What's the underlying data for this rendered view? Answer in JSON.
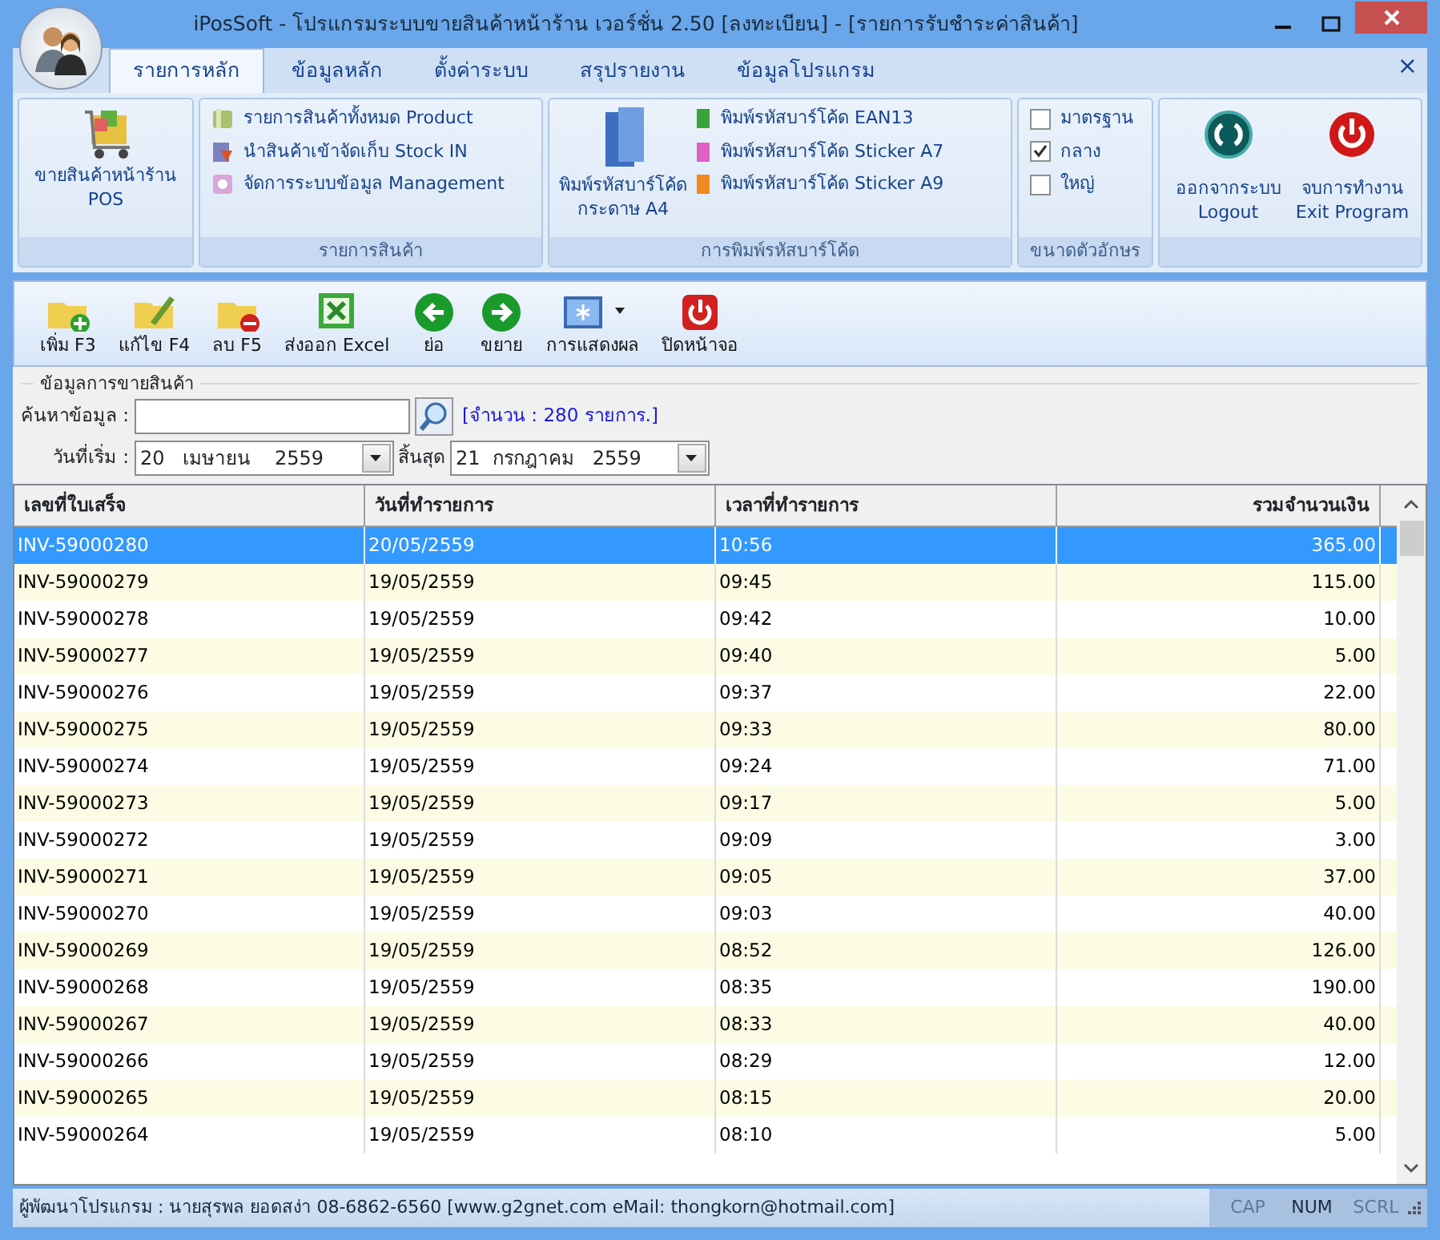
{
  "window": {
    "title": "iPosSoft - โปรแกรมระบบขายสินค้าหน้าร้าน เวอร์ชั่น 2.50 [ลงทะเบียน] - [รายการรับชำระค่าสินค้า]"
  },
  "ribbon": {
    "tabs": [
      {
        "label": "รายการหลัก",
        "selected": true
      },
      {
        "label": "ข้อมูลหลัก",
        "selected": false
      },
      {
        "label": "ตั้งค่าระบบ",
        "selected": false
      },
      {
        "label": "สรุปรายงาน",
        "selected": false
      },
      {
        "label": "ข้อมูลโปรแกรม",
        "selected": false
      }
    ],
    "close_label": "×",
    "groups": [
      {
        "kind": "pos",
        "items": [
          {
            "lines": [
              "ขายสินค้าหน้าร้าน",
              "POS"
            ]
          }
        ]
      },
      {
        "kind": "list",
        "title": "รายการสินค้า",
        "items": [
          {
            "label": "รายการสินค้าทั้งหมด Product"
          },
          {
            "label": "นำสินค้าเข้าจัดเก็บ Stock IN"
          },
          {
            "label": "จัดการระบบข้อมูล Management"
          }
        ]
      },
      {
        "kind": "barcode",
        "title": "การพิมพ์รหัสบาร์โค้ด",
        "big": {
          "lines": [
            "พิมพ์รหัสบาร์โค้ด",
            "กระดาษ A4"
          ]
        },
        "items": [
          {
            "label": "พิมพ์รหัสบาร์โค้ด EAN13",
            "color": "#3aa43a"
          },
          {
            "label": "พิมพ์รหัสบาร์โค้ด Sticker A7",
            "color": "#e060c8"
          },
          {
            "label": "พิมพ์รหัสบาร์โค้ด Sticker A9",
            "color": "#f08a20"
          }
        ]
      },
      {
        "kind": "checks",
        "title": "ขนาดตัวอักษร",
        "items": [
          {
            "label": "มาตรฐาน",
            "checked": false
          },
          {
            "label": "กลาง",
            "checked": true
          },
          {
            "label": "ใหญ่",
            "checked": false
          }
        ]
      },
      {
        "kind": "exit",
        "items": [
          {
            "lines": [
              "ออกจากระบบ",
              "Logout"
            ]
          },
          {
            "lines": [
              "จบการทำงาน",
              "Exit Program"
            ]
          }
        ]
      }
    ]
  },
  "toolbar": [
    {
      "label": "เพิ่ม F3"
    },
    {
      "label": "แก้ไข F4"
    },
    {
      "label": "ลบ F5"
    },
    {
      "label": "ส่งออก Excel"
    },
    {
      "label": "ย่อ"
    },
    {
      "label": "ขยาย"
    },
    {
      "label": "การแสดงผล"
    },
    {
      "label": "ปิดหน้าจอ"
    }
  ],
  "filter": {
    "legend": "ข้อมูลการขายสินค้า",
    "search_label": "ค้นหาข้อมูล :",
    "count": "[จำนวน : 280 รายการ.]",
    "start_label": "วันที่เริ่ม :",
    "start_date": "20   เมษายน    2559",
    "end_label": "สิ้นสุด",
    "end_date": "21  กรกฎาคม   2559"
  },
  "table": {
    "columns": [
      "เลขที่ใบเสร็จ",
      "วันที่ทำรายการ",
      "เวลาที่ทำรายการ",
      "รวมจำนวนเงิน"
    ],
    "rows": [
      {
        "cells": [
          "INV-59000280",
          "20/05/2559",
          "10:56",
          "365.00"
        ],
        "selected": true
      },
      {
        "cells": [
          "INV-59000279",
          "19/05/2559",
          "09:45",
          "115.00"
        ],
        "selected": false
      },
      {
        "cells": [
          "INV-59000278",
          "19/05/2559",
          "09:42",
          "10.00"
        ],
        "selected": false
      },
      {
        "cells": [
          "INV-59000277",
          "19/05/2559",
          "09:40",
          "5.00"
        ],
        "selected": false
      },
      {
        "cells": [
          "INV-59000276",
          "19/05/2559",
          "09:37",
          "22.00"
        ],
        "selected": false
      },
      {
        "cells": [
          "INV-59000275",
          "19/05/2559",
          "09:33",
          "80.00"
        ],
        "selected": false
      },
      {
        "cells": [
          "INV-59000274",
          "19/05/2559",
          "09:24",
          "71.00"
        ],
        "selected": false
      },
      {
        "cells": [
          "INV-59000273",
          "19/05/2559",
          "09:17",
          "5.00"
        ],
        "selected": false
      },
      {
        "cells": [
          "INV-59000272",
          "19/05/2559",
          "09:09",
          "3.00"
        ],
        "selected": false
      },
      {
        "cells": [
          "INV-59000271",
          "19/05/2559",
          "09:05",
          "37.00"
        ],
        "selected": false
      },
      {
        "cells": [
          "INV-59000270",
          "19/05/2559",
          "09:03",
          "40.00"
        ],
        "selected": false
      },
      {
        "cells": [
          "INV-59000269",
          "19/05/2559",
          "08:52",
          "126.00"
        ],
        "selected": false
      },
      {
        "cells": [
          "INV-59000268",
          "19/05/2559",
          "08:35",
          "190.00"
        ],
        "selected": false
      },
      {
        "cells": [
          "INV-59000267",
          "19/05/2559",
          "08:33",
          "40.00"
        ],
        "selected": false
      },
      {
        "cells": [
          "INV-59000266",
          "19/05/2559",
          "08:29",
          "12.00"
        ],
        "selected": false
      },
      {
        "cells": [
          "INV-59000265",
          "19/05/2559",
          "08:15",
          "20.00"
        ],
        "selected": false
      },
      {
        "cells": [
          "INV-59000264",
          "19/05/2559",
          "08:10",
          "5.00"
        ],
        "selected": false
      }
    ]
  },
  "status_bar": {
    "text": "ผู้พัฒนาโปรแกรม : นายสุรพล ยอดสง่า 08-6862-6560 [www.g2gnet.com  eMail: thongkorn@hotmail.com]",
    "indicators": [
      {
        "label": "CAP",
        "on": false
      },
      {
        "label": "NUM",
        "on": true
      },
      {
        "label": "SCRL",
        "on": false
      }
    ]
  }
}
